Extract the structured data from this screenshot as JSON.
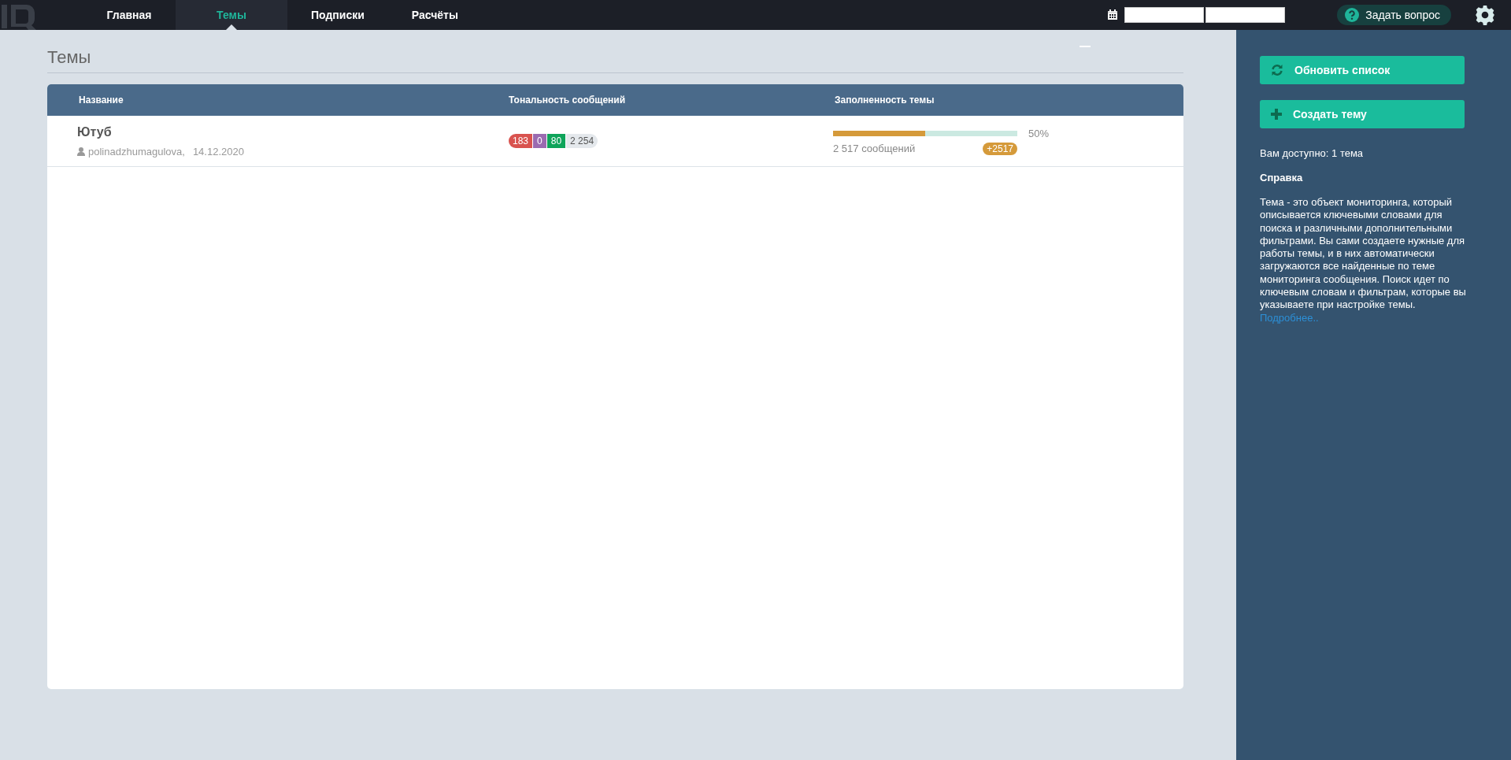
{
  "nav": {
    "tabs": [
      {
        "label": "Главная",
        "selected": false
      },
      {
        "label": "Темы",
        "selected": true
      },
      {
        "label": "Подписки",
        "selected": false
      },
      {
        "label": "Расчёты",
        "selected": false
      }
    ],
    "ask_button": "Задать вопрос"
  },
  "page": {
    "title": "Темы"
  },
  "table": {
    "columns": [
      "Название",
      "Тональность сообщений",
      "Заполненность темы"
    ],
    "rows": [
      {
        "name": "Ютуб",
        "author": "polinadzhumagulova,",
        "date": "14.12.2020",
        "sentiment": [
          {
            "value": "183",
            "color": "#d9534f"
          },
          {
            "value": "0",
            "color": "#9b6bb0"
          },
          {
            "value": "80",
            "color": "#0fa45a"
          },
          {
            "value": "2 254",
            "color": "#e4e8ec"
          }
        ],
        "fill": {
          "level": 0.5,
          "reading": "50%",
          "count": "2 517 сообщений",
          "badge": "+2517"
        }
      }
    ]
  },
  "sidebar": {
    "buttons": [
      {
        "label": "Обновить список",
        "kind": "refresh"
      },
      {
        "label": "Создать тему",
        "kind": "plus"
      }
    ],
    "quota": "Вам доступно: 1 тема",
    "help_title": "Справка",
    "help_text": "Тема - это объект мониторинга, который описывается ключевыми словами для поиска и различными дополнительными фильтрами. Вы сами создаете нужные для работы темы, и в них автоматически загружаются все найденные по теме мониторинга сообщения. Поиск идет по ключевым словам и фильтрам, которые вы указываете при настройке темы.",
    "help_link": "Подробнее.."
  }
}
